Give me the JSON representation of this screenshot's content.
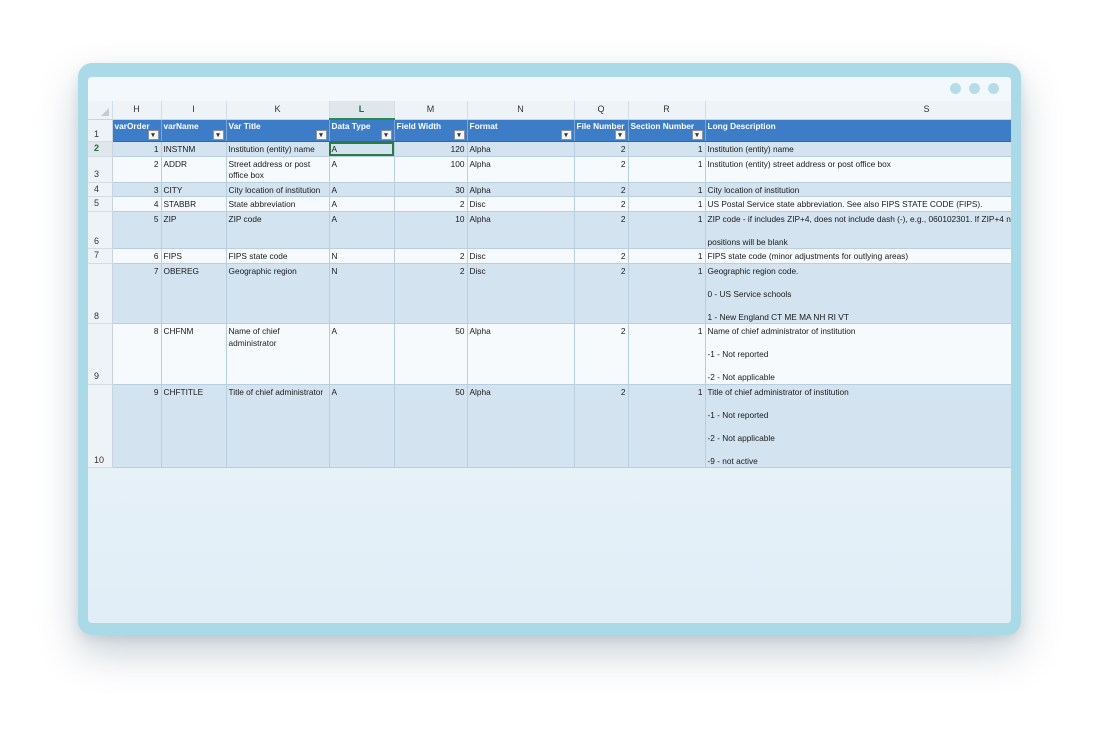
{
  "columns": [
    "H",
    "I",
    "K",
    "L",
    "M",
    "N",
    "Q",
    "R",
    "S"
  ],
  "active_column": "L",
  "headers": [
    "varOrder",
    "varName",
    "Var Title",
    "Data Type",
    "Field Width",
    "Format",
    "File Number",
    "Section Number",
    "Long Description"
  ],
  "rows": [
    {
      "rownum": "2",
      "active": true,
      "varOrder": "1",
      "varName": "INSTNM",
      "varTitle": "Institution (entity) name",
      "dataType": "A",
      "fieldWidth": "120",
      "format": "Alpha",
      "fileNumber": "2",
      "sectionNumber": "1",
      "desc": [
        "Institution (entity) name"
      ]
    },
    {
      "rownum": "3",
      "varOrder": "2",
      "varName": "ADDR",
      "varTitle": "Street address or post office box",
      "dataType": "A",
      "fieldWidth": "100",
      "format": "Alpha",
      "fileNumber": "2",
      "sectionNumber": "1",
      "desc": [
        "Institution (entity) street address or post office box"
      ]
    },
    {
      "rownum": "4",
      "varOrder": "3",
      "varName": "CITY",
      "varTitle": "City location of institution",
      "dataType": "A",
      "fieldWidth": "30",
      "format": "Alpha",
      "fileNumber": "2",
      "sectionNumber": "1",
      "desc": [
        "City location of institution"
      ]
    },
    {
      "rownum": "5",
      "varOrder": "4",
      "varName": "STABBR",
      "varTitle": "State abbreviation",
      "dataType": "A",
      "fieldWidth": "2",
      "format": "Disc",
      "fileNumber": "2",
      "sectionNumber": "1",
      "desc": [
        "US Postal Service state abbreviation. See also FIPS STATE CODE (FIPS)."
      ]
    },
    {
      "rownum": "6",
      "varOrder": "5",
      "varName": "ZIP",
      "varTitle": "ZIP code",
      "dataType": "A",
      "fieldWidth": "10",
      "format": "Alpha",
      "fileNumber": "2",
      "sectionNumber": "1",
      "desc": [
        "ZIP code - if includes ZIP+4, does not include dash (-), e.g., 060102301. If ZIP+4 n",
        "positions will be blank"
      ]
    },
    {
      "rownum": "7",
      "varOrder": "6",
      "varName": "FIPS",
      "varTitle": "FIPS state code",
      "dataType": "N",
      "fieldWidth": "2",
      "format": "Disc",
      "fileNumber": "2",
      "sectionNumber": "1",
      "desc": [
        "FIPS state code (minor adjustments for outlying areas)"
      ]
    },
    {
      "rownum": "8",
      "varOrder": "7",
      "varName": "OBEREG",
      "varTitle": "Geographic region",
      "dataType": "N",
      "fieldWidth": "2",
      "format": "Disc",
      "fileNumber": "2",
      "sectionNumber": "1",
      "desc": [
        "Geographic region code.",
        "0 - US Service schools",
        "1 - New England CT ME MA NH RI VT"
      ]
    },
    {
      "rownum": "9",
      "varOrder": "8",
      "varName": "CHFNM",
      "varTitle": "Name of chief administrator",
      "dataType": "A",
      "fieldWidth": "50",
      "format": "Alpha",
      "fileNumber": "2",
      "sectionNumber": "1",
      "desc": [
        "Name of chief administrator of institution",
        "-1 - Not reported",
        "-2 - Not applicable"
      ]
    },
    {
      "rownum": "10",
      "varOrder": "9",
      "varName": "CHFTITLE",
      "varTitle": "Title of chief administrator",
      "dataType": "A",
      "fieldWidth": "50",
      "format": "Alpha",
      "fileNumber": "2",
      "sectionNumber": "1",
      "desc": [
        "Title of chief administrator of institution",
        "-1 - Not reported",
        "-2 - Not applicable",
        "-9 - not active"
      ]
    }
  ]
}
